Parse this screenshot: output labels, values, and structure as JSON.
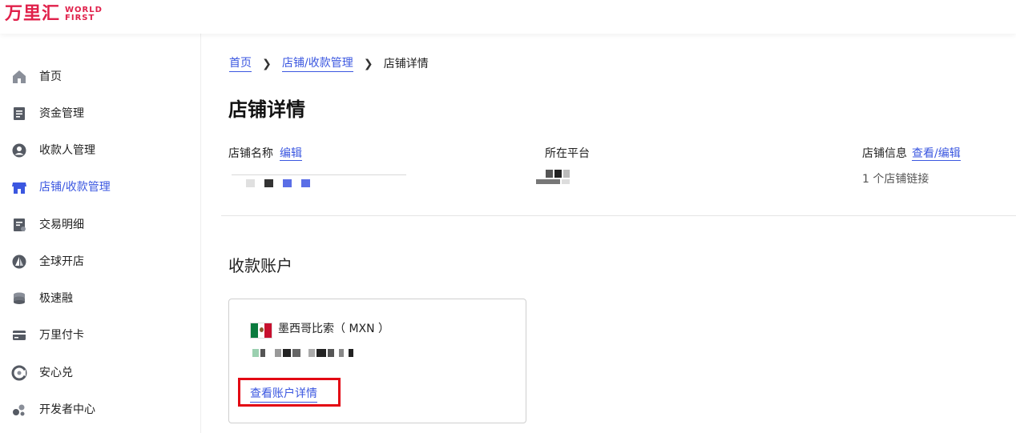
{
  "header": {
    "logo_cn": "万里汇",
    "logo_en_line1": "WORLD",
    "logo_en_line2": "FIRST",
    "brand_color": "#e0204a"
  },
  "sidebar": {
    "items": [
      {
        "label": "首页",
        "icon": "home-icon"
      },
      {
        "label": "资金管理",
        "icon": "ledger-icon"
      },
      {
        "label": "收款人管理",
        "icon": "user-icon"
      },
      {
        "label": "店铺/收款管理",
        "icon": "store-icon",
        "active": true
      },
      {
        "label": "交易明细",
        "icon": "transactions-icon"
      },
      {
        "label": "全球开店",
        "icon": "sailboat-icon"
      },
      {
        "label": "极速融",
        "icon": "coins-icon"
      },
      {
        "label": "万里付卡",
        "icon": "card-icon"
      },
      {
        "label": "安心兑",
        "icon": "exchange-icon"
      },
      {
        "label": "开发者中心",
        "icon": "developer-icon"
      }
    ],
    "active_color": "#3b57e0"
  },
  "breadcrumb": {
    "home": "首页",
    "store_management": "店铺/收款管理",
    "current": "店铺详情"
  },
  "page_title": "店铺详情",
  "store_info": {
    "name_label": "店铺名称",
    "name_edit": "编辑",
    "platform_label": "所在平台",
    "info_label": "店铺信息",
    "info_link": "查看/编辑",
    "store_links": "1 个店铺链接"
  },
  "receiving_accounts": {
    "title": "收款账户",
    "card": {
      "currency": "墨西哥比索（ MXN ）",
      "flag": "mexico-flag-icon",
      "details_link": "查看账户详情"
    }
  }
}
